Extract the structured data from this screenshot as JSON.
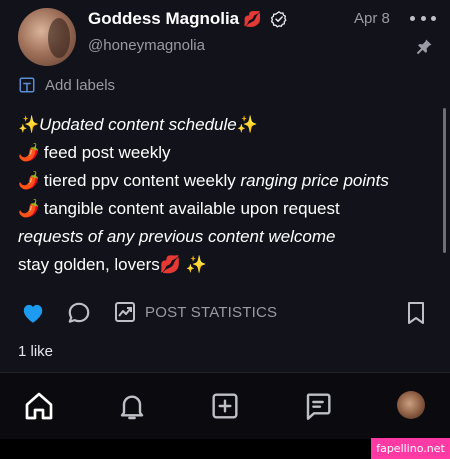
{
  "post": {
    "display_name": "Goddess Magnolia",
    "name_emoji": "💋",
    "handle": "@honeymagnolia",
    "date": "Apr 8",
    "add_labels": "Add labels",
    "content": {
      "line1_prefix": "✨",
      "line1_text": "Updated content schedule",
      "line1_suffix": "✨",
      "line2_emoji": "🌶️",
      "line2_text": " feed post weekly",
      "line3_emoji": "🌶️",
      "line3_text": " tiered ppv content weekly ",
      "line3_italic": "ranging price points",
      "line4_emoji": "🌶️",
      "line4_text": " tangible content available upon request",
      "line5_italic": "requests of any previous content welcome",
      "line6_text": "stay golden, lovers",
      "line6_emoji": "💋 ✨"
    },
    "post_statistics": "POST STATISTICS",
    "likes": "1 like"
  },
  "colors": {
    "like_heart": "#1d9bf0",
    "watermark_bg": "#ff3aa5"
  },
  "watermark": "fapellino.net",
  "icons": [
    "verified-icon",
    "more-icon",
    "pin-icon",
    "label-icon",
    "heart-icon",
    "comment-icon",
    "statistics-icon",
    "bookmark-icon",
    "home-icon",
    "bell-icon",
    "add-icon",
    "messages-icon"
  ]
}
